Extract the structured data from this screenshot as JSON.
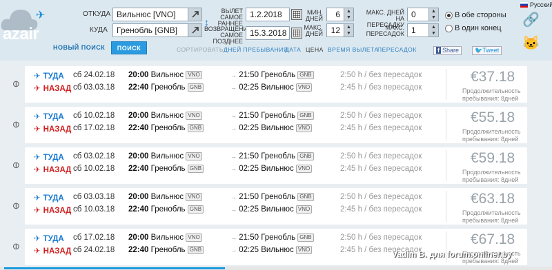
{
  "brand": {
    "logo_text": "azair"
  },
  "form": {
    "from_label": "ОТКУДА",
    "from_value": "Вильнюс [VNO]",
    "to_label": "КУДА",
    "to_value": "Гренобль [GNB]",
    "depart_label_1": "ВЫЛЕТ",
    "depart_label_2": "САМОЕ",
    "depart_label_3": "РАННЕЕ",
    "depart_value": "1.2.2018",
    "return_label_1": "ВОЗВРАЩЕНИЕ",
    "return_label_2": "САМОЕ",
    "return_label_3": "ПОЗДНЕЕ",
    "return_value": "15.3.2018",
    "min_days_label_1": "МИН.",
    "min_days_label_2": "ДНЕЙ",
    "min_days_value": "6",
    "max_days_label_1": "МАКС.",
    "max_days_label_2": "ДНЕЙ",
    "max_days_value": "12",
    "max_transfer_days_label_1": "МАКС. ДНЕЙ",
    "max_transfer_days_label_2": "НА ПЕРЕСАДКУ",
    "max_transfer_days_value": "0",
    "max_transfers_label_1": "МАКС.",
    "max_transfers_label_2": "ПЕРЕСАДОК",
    "max_transfers_value": "1",
    "radio_both": "В обе стороны",
    "radio_one": "В один конец",
    "new_search": "НОВЫЙ ПОИСК",
    "search_button": "ПОИСК"
  },
  "sort": {
    "label": "СОРТИРОВАТЬ:",
    "items": [
      "ДНЕЙ ПРЕБЫВАНИЯ",
      "ДАТА",
      "ЦЕНА",
      "ВРЕМЯ ВЫЛЕТА",
      "ПЕРЕСАДОК"
    ],
    "active": "ЦЕНА"
  },
  "social": {
    "share": "Share",
    "tweet": "Tweet"
  },
  "language": "Русский",
  "labels": {
    "out": "ТУДА",
    "back": "НАЗАД",
    "stay_1": "Продолжительность",
    "stay_2": "пребывания: 8дней"
  },
  "results": [
    {
      "out_date": "сб 24.02.18",
      "out_dep": "20:00",
      "out_from": "Вильнюс",
      "out_from_code": "VNO",
      "out_arr": "21:50",
      "out_to": "Гренобль",
      "out_to_code": "GNB",
      "out_dur": "2:50 h / без пересадок",
      "back_date": "сб 03.03.18",
      "back_dep": "22:40",
      "back_from": "Гренобль",
      "back_from_code": "GNB",
      "back_arr": "02:25",
      "back_to": "Вильнюс",
      "back_to_code": "VNO",
      "back_dur": "2:45 h / без пересадок",
      "price": "€37.18"
    },
    {
      "out_date": "сб 10.02.18",
      "out_dep": "20:00",
      "out_from": "Вильнюс",
      "out_from_code": "VNO",
      "out_arr": "21:50",
      "out_to": "Гренобль",
      "out_to_code": "GNB",
      "out_dur": "2:50 h / без пересадок",
      "back_date": "сб 17.02.18",
      "back_dep": "22:40",
      "back_from": "Гренобль",
      "back_from_code": "GNB",
      "back_arr": "02:25",
      "back_to": "Вильнюс",
      "back_to_code": "VNO",
      "back_dur": "2:45 h / без пересадок",
      "price": "€55.18"
    },
    {
      "out_date": "сб 03.02.18",
      "out_dep": "20:00",
      "out_from": "Вильнюс",
      "out_from_code": "VNO",
      "out_arr": "21:50",
      "out_to": "Гренобль",
      "out_to_code": "GNB",
      "out_dur": "2:50 h / без пересадок",
      "back_date": "сб 10.02.18",
      "back_dep": "22:40",
      "back_from": "Гренобль",
      "back_from_code": "GNB",
      "back_arr": "02:25",
      "back_to": "Вильнюс",
      "back_to_code": "VNO",
      "back_dur": "2:45 h / без пересадок",
      "price": "€59.18"
    },
    {
      "out_date": "сб 03.03.18",
      "out_dep": "20:00",
      "out_from": "Вильнюс",
      "out_from_code": "VNO",
      "out_arr": "21:50",
      "out_to": "Гренобль",
      "out_to_code": "GNB",
      "out_dur": "2:50 h / без пересадок",
      "back_date": "сб 10.03.18",
      "back_dep": "22:40",
      "back_from": "Гренобль",
      "back_from_code": "GNB",
      "back_arr": "02:25",
      "back_to": "Вильнюс",
      "back_to_code": "VNO",
      "back_dur": "2:45 h / без пересадок",
      "price": "€63.18"
    },
    {
      "out_date": "сб 17.02.18",
      "out_dep": "20:00",
      "out_from": "Вильнюс",
      "out_from_code": "VNO",
      "out_arr": "21:50",
      "out_to": "Гренобль",
      "out_to_code": "GNB",
      "out_dur": "2:50 h / без пересадок",
      "back_date": "сб 24.02.18",
      "back_dep": "22:40",
      "back_from": "Гренобль",
      "back_from_code": "GNB",
      "back_arr": "02:25",
      "back_to": "Вильнюс",
      "back_to_code": "VNO",
      "back_dur": "2:45 h / без пересадок",
      "price": "€67.18"
    }
  ],
  "watermark": "Vadim B. для forum.onliner.by",
  "colors": {
    "accent": "#2a9be0",
    "out": "#1a7ad0",
    "back": "#d11d1d",
    "header_bg": "#dce8f0"
  }
}
